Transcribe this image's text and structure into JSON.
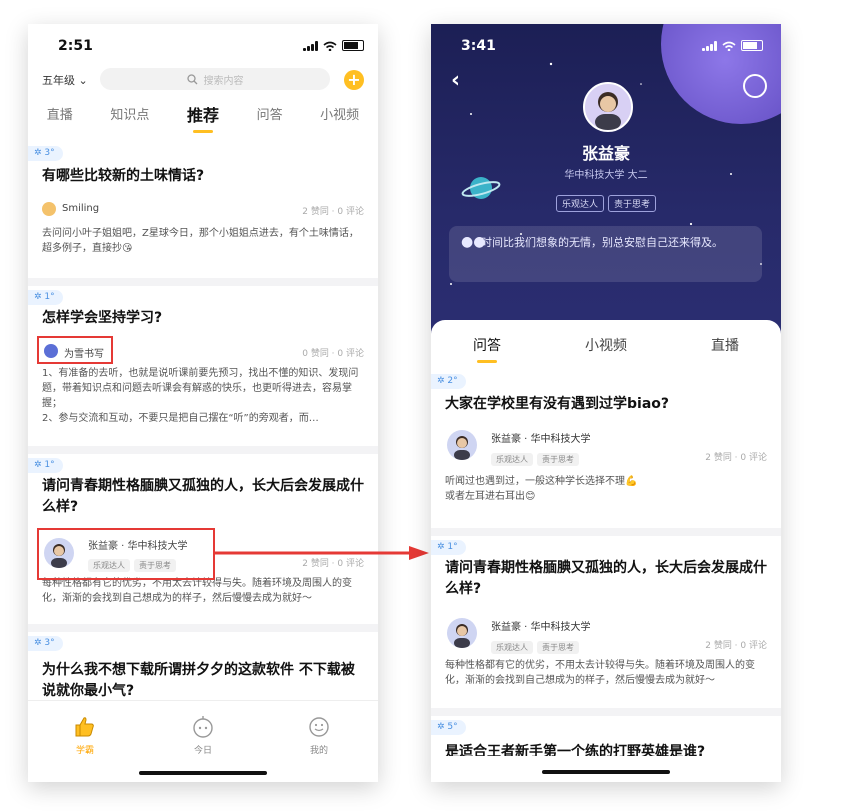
{
  "left": {
    "status_time": "2:51",
    "grade": "五年级",
    "search_placeholder": "搜索内容",
    "plus": "+",
    "tabs": [
      "直播",
      "知识点",
      "推荐",
      "问答",
      "小视频"
    ],
    "cards": [
      {
        "badge": "3°",
        "title": "有哪些比较新的土味情话?",
        "user": "Smiling",
        "stats": "2 赞同 · 0 评论",
        "body": "去问问小叶子姐姐吧，Z星球今日，那个小姐姐点进去，有个土味情话，超多例子，直接抄😘"
      },
      {
        "badge": "1°",
        "title": "怎样学会坚持学习?",
        "user": "为雪书写",
        "stats": "0 赞同 · 0 评论",
        "body": "1、有准备的去听，也就是说听课前要先预习，找出不懂的知识、发现问题，带着知识点和问题去听课会有解惑的快乐，也更听得进去，容易掌握；\n2、参与交流和互动，不要只是把自己摆在“听”的旁观者，而…"
      },
      {
        "badge": "1°",
        "title": "请问青春期性格腼腆又孤独的人，长大后会发展成什么样?",
        "user": "张益豪 · 华中科技大学",
        "tags": [
          "乐观达人",
          "责于思考"
        ],
        "stats": "2 赞同 · 0 评论",
        "body": "每种性格都有它的优劣，不用太去计较得与失。随着环境及周围人的变化，渐渐的会找到自己想成为的样子，然后慢慢去成为就好～"
      },
      {
        "badge": "3°",
        "title": "为什么我不想下载所谓拼夕夕的这款软件      不下载被说就你最小气?"
      }
    ],
    "bottom_nav": [
      "学霸",
      "今日",
      "我的"
    ]
  },
  "right": {
    "status_time": "3:41",
    "name": "张益豪",
    "school": "华中科技大学 大二",
    "tags": [
      "乐观达人",
      "责于思考"
    ],
    "motto_mark": "●●",
    "motto": "时间比我们想象的无情，别总安慰自己还来得及。",
    "tabs": [
      "问答",
      "小视频",
      "直播"
    ],
    "cards": [
      {
        "badge": "2°",
        "title": "大家在学校里有没有遇到过学biao?",
        "user": "张益豪 · 华中科技大学",
        "tags": [
          "乐观达人",
          "责于思考"
        ],
        "stats": "2 赞同 · 0 评论",
        "body": "听闻过也遇到过，一般这种学长选择不理💪\n或者左耳进右耳出😊"
      },
      {
        "badge": "1°",
        "title": "请问青春期性格腼腆又孤独的人，长大后会发展成什么样?",
        "user": "张益豪 · 华中科技大学",
        "tags": [
          "乐观达人",
          "责于思考"
        ],
        "stats": "2 赞同 · 0 评论",
        "body": "每种性格都有它的优劣，不用太去计较得与失。随着环境及周围人的变化，渐渐的会找到自己想成为的样子，然后慢慢去成为就好～"
      },
      {
        "badge": "5°",
        "title": "是适合王者新手第一个练的打野英雄是谁?"
      }
    ]
  },
  "colors": {
    "accent": "#ffbf22",
    "highlight": "#e53935",
    "badge_text": "#4a90e2",
    "header_bg": "#1c1f55"
  }
}
